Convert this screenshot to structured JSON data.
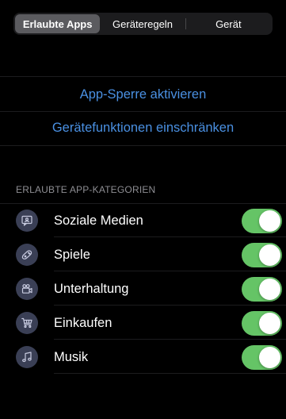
{
  "tabs": [
    {
      "label": "Erlaubte Apps",
      "selected": true
    },
    {
      "label": "Geräteregeln",
      "selected": false
    },
    {
      "label": "Gerät",
      "selected": false
    }
  ],
  "actions": {
    "app_lock": "App-Sperre aktivieren",
    "restrict_features": "Gerätefunktionen einschränken"
  },
  "section": {
    "header": "ERLAUBTE APP-KATEGORIEN"
  },
  "categories": [
    {
      "label": "Soziale Medien",
      "icon": "social-media-icon",
      "enabled": true
    },
    {
      "label": "Spiele",
      "icon": "game-controller-icon",
      "enabled": true
    },
    {
      "label": "Unterhaltung",
      "icon": "film-camera-icon",
      "enabled": true
    },
    {
      "label": "Einkaufen",
      "icon": "shopping-cart-icon",
      "enabled": true
    },
    {
      "label": "Musik",
      "icon": "music-note-icon",
      "enabled": true
    }
  ],
  "colors": {
    "accent": "#4a90e2",
    "toggle_on": "#65c466",
    "icon_bg": "#3a3f55",
    "background": "#000000",
    "section_header": "#8e8e93"
  }
}
